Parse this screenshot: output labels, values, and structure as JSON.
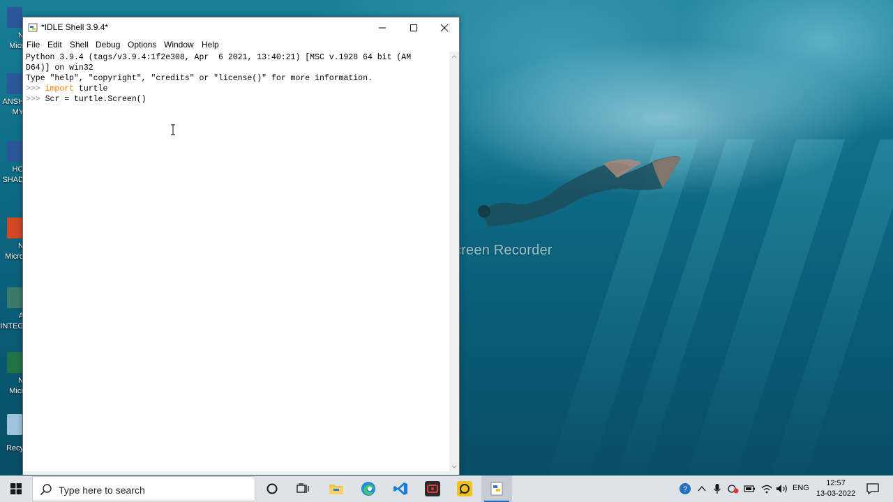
{
  "window": {
    "title": "*IDLE Shell 3.9.4*",
    "menu": [
      "File",
      "Edit",
      "Shell",
      "Debug",
      "Options",
      "Window",
      "Help"
    ]
  },
  "shell": {
    "line1": "Python 3.9.4 (tags/v3.9.4:1f2e308, Apr  6 2021, 13:40:21) [MSC v.1928 64 bit (AM",
    "line2": "D64)] on win32",
    "line3": "Type \"help\", \"copyright\", \"credits\" or \"license()\" for more information.",
    "prompt": ">>> ",
    "cmd1_keyword": "import",
    "cmd1_rest": " turtle",
    "cmd2": "Scr = turtle.Screen()"
  },
  "watermark": "Recorded with iTop Screen Recorder",
  "desktop_icons": [
    {
      "label": "N\nMicr",
      "color": "#2b579a"
    },
    {
      "label": "ANSH\nMY",
      "color": "#2b579a"
    },
    {
      "label": "HO\nSHAD",
      "color": "#2b579a"
    },
    {
      "label": "N\nMicro",
      "color": "#d24726"
    },
    {
      "label": "A\nINTEG",
      "color": "#3a7a6a"
    },
    {
      "label": "N\nMicr",
      "color": "#217346"
    },
    {
      "label": "Recy",
      "color": "#9fc3de"
    }
  ],
  "taskbar": {
    "search_placeholder": "Type here to search",
    "apps": [
      "cortana-icon",
      "task-view-icon",
      "file-explorer-icon",
      "edge-icon",
      "vscode-icon",
      "itop-recorder-icon",
      "yellow-app-icon",
      "python-idle-icon"
    ],
    "language": "ENG",
    "time": "12:57",
    "date": "13-03-2022"
  },
  "colors": {
    "prompt": "#8b8b8b",
    "keyword": "#ff7700",
    "taskbar": "#dfe3e8"
  }
}
